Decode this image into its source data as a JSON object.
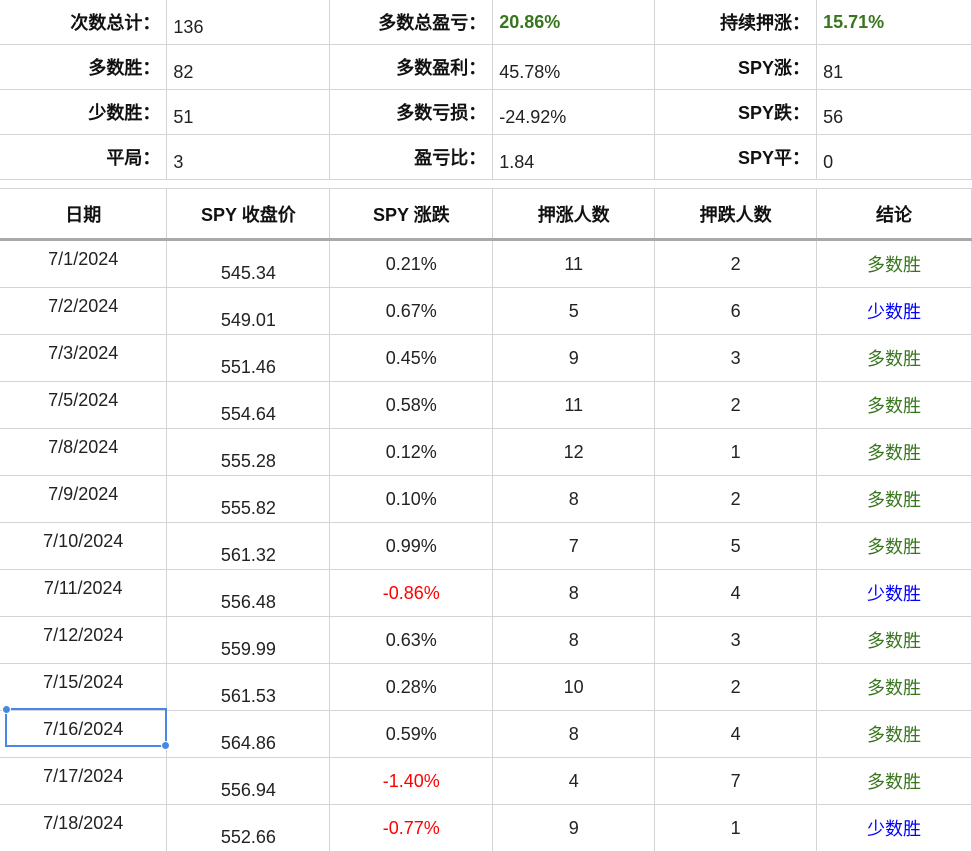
{
  "summary": {
    "rows": [
      [
        {
          "label": "次数总计：",
          "value": "136"
        },
        {
          "label": "多数总盈亏：",
          "value": "20.86%",
          "highlight": true
        },
        {
          "label": "持续押涨：",
          "value": "15.71%",
          "highlight": true
        }
      ],
      [
        {
          "label": "多数胜：",
          "value": "82"
        },
        {
          "label": "多数盈利：",
          "value": "45.78%"
        },
        {
          "label": "SPY涨：",
          "value": "81"
        }
      ],
      [
        {
          "label": "少数胜：",
          "value": "51"
        },
        {
          "label": "多数亏损：",
          "value": "-24.92%"
        },
        {
          "label": "SPY跌：",
          "value": "56"
        }
      ],
      [
        {
          "label": "平局：",
          "value": "3"
        },
        {
          "label": "盈亏比：",
          "value": "1.84"
        },
        {
          "label": "SPY平：",
          "value": "0"
        }
      ]
    ]
  },
  "table": {
    "headers": [
      "日期",
      "SPY 收盘价",
      "SPY 涨跌",
      "押涨人数",
      "押跌人数",
      "结论"
    ],
    "rows": [
      [
        "7/1/2024",
        "545.34",
        "0.21%",
        "11",
        "2",
        "多数胜"
      ],
      [
        "7/2/2024",
        "549.01",
        "0.67%",
        "5",
        "6",
        "少数胜"
      ],
      [
        "7/3/2024",
        "551.46",
        "0.45%",
        "9",
        "3",
        "多数胜"
      ],
      [
        "7/5/2024",
        "554.64",
        "0.58%",
        "11",
        "2",
        "多数胜"
      ],
      [
        "7/8/2024",
        "555.28",
        "0.12%",
        "12",
        "1",
        "多数胜"
      ],
      [
        "7/9/2024",
        "555.82",
        "0.10%",
        "8",
        "2",
        "多数胜"
      ],
      [
        "7/10/2024",
        "561.32",
        "0.99%",
        "7",
        "5",
        "多数胜"
      ],
      [
        "7/11/2024",
        "556.48",
        "-0.86%",
        "8",
        "4",
        "少数胜"
      ],
      [
        "7/12/2024",
        "559.99",
        "0.63%",
        "8",
        "3",
        "多数胜"
      ],
      [
        "7/15/2024",
        "561.53",
        "0.28%",
        "10",
        "2",
        "多数胜"
      ],
      [
        "7/16/2024",
        "564.86",
        "0.59%",
        "8",
        "4",
        "多数胜"
      ],
      [
        "7/17/2024",
        "556.94",
        "-1.40%",
        "4",
        "7",
        "多数胜"
      ],
      [
        "7/18/2024",
        "552.66",
        "-0.77%",
        "9",
        "1",
        "少数胜"
      ]
    ]
  },
  "colors": {
    "positive_highlight": "#38761d",
    "negative_change": "#ff0000",
    "majority_win": "#38761d",
    "minority_win": "#0000ff",
    "selection": "#4a86e8"
  }
}
